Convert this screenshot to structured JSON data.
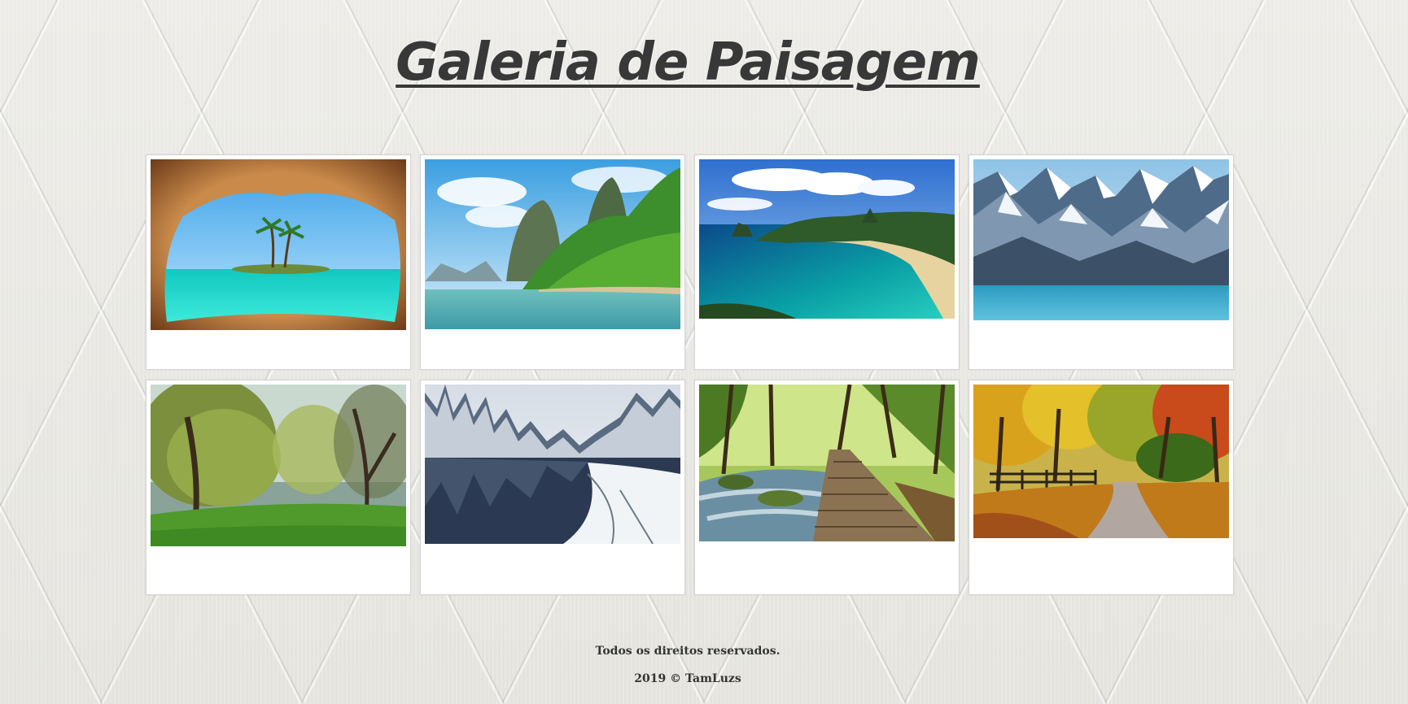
{
  "page": {
    "title": "Galeria de Paisagem"
  },
  "gallery": {
    "images": [
      {
        "name": "cave-island-image"
      },
      {
        "name": "river-cliffs-image"
      },
      {
        "name": "bay-beach-image"
      },
      {
        "name": "snow-mountains-image"
      },
      {
        "name": "willow-park-image"
      },
      {
        "name": "winter-river-image"
      },
      {
        "name": "forest-boardwalk-image"
      },
      {
        "name": "autumn-lane-image"
      }
    ]
  },
  "footer": {
    "rights": "Todos os direitos reservados.",
    "copyright": "2019 © TamLuzs"
  },
  "colors": {
    "title": "#383838",
    "card_background": "#ffffff",
    "card_border": "#d4d4d4"
  }
}
